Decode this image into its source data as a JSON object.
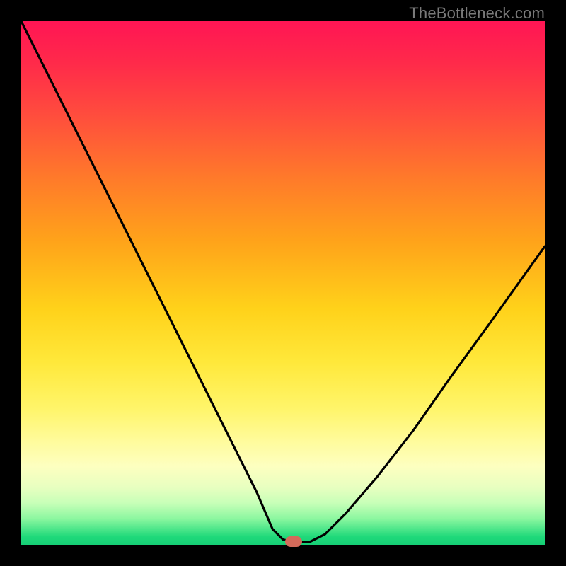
{
  "watermark": "TheBottleneck.com",
  "chart_data": {
    "type": "line",
    "title": "",
    "xlabel": "",
    "ylabel": "",
    "xlim": [
      0,
      100
    ],
    "ylim": [
      0,
      100
    ],
    "series": [
      {
        "name": "bottleneck-curve",
        "x": [
          0,
          5,
          10,
          15,
          20,
          25,
          30,
          35,
          40,
          45,
          48,
          50,
          52,
          55,
          58,
          62,
          68,
          75,
          82,
          90,
          100
        ],
        "values": [
          100,
          90,
          80,
          70,
          60,
          50,
          40,
          30,
          20,
          10,
          3,
          1,
          0.5,
          0.5,
          2,
          6,
          13,
          22,
          32,
          43,
          57
        ]
      }
    ],
    "marker": {
      "x": 52,
      "y": 0.5
    },
    "gradient_stops": [
      {
        "pos": 0,
        "color": "#ff1554"
      },
      {
        "pos": 50,
        "color": "#ffd21a"
      },
      {
        "pos": 85,
        "color": "#fdffc0"
      },
      {
        "pos": 100,
        "color": "#16cf76"
      }
    ]
  }
}
